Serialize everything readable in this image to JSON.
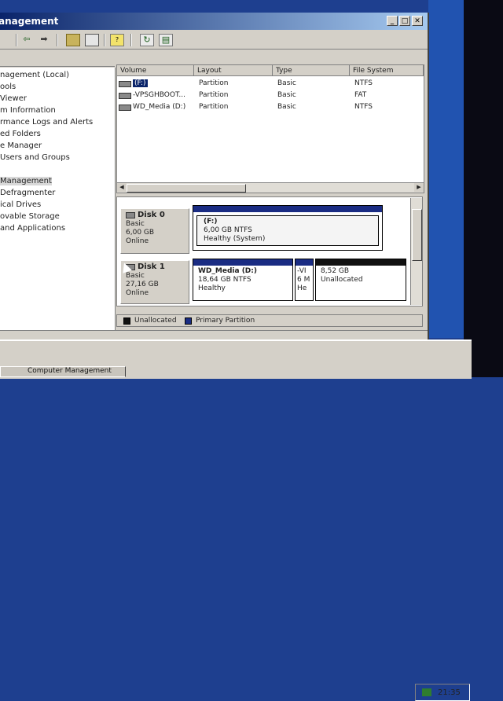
{
  "window": {
    "title": "anagement",
    "controls": [
      "_",
      "□",
      "✕"
    ]
  },
  "toolbar": {
    "icons": [
      "back-arrow-icon",
      "forward-arrow-icon",
      "up-folder-icon",
      "properties-icon",
      "help-icon",
      "refresh-icon",
      "export-icon"
    ]
  },
  "tree": {
    "items": [
      "nagement (Local)",
      "ools",
      " Viewer",
      "m Information",
      "rmance Logs and Alerts",
      "ed Folders",
      "e Manager",
      " Users and Groups",
      "",
      "Management",
      "Defragmenter",
      "ical Drives",
      "ovable Storage",
      " and Applications"
    ],
    "selected_index": 9
  },
  "volumes": {
    "columns": [
      "Volume",
      "Layout",
      "Type",
      "File System"
    ],
    "rows": [
      {
        "volume": "(F:)",
        "layout": "Partition",
        "type": "Basic",
        "fs": "NTFS"
      },
      {
        "volume": "-VPSGHBOOT...",
        "layout": "Partition",
        "type": "Basic",
        "fs": "FAT"
      },
      {
        "volume": "WD_Media (D:)",
        "layout": "Partition",
        "type": "Basic",
        "fs": "NTFS"
      }
    ]
  },
  "disks": [
    {
      "name": "Disk 0",
      "kind": "Basic",
      "size": "6,00 GB",
      "status": "Online",
      "partitions": [
        {
          "name": "(F:)",
          "size": "6,00 GB NTFS",
          "status": "Healthy (System)"
        }
      ]
    },
    {
      "name": "Disk 1",
      "kind": "Basic",
      "size": "27,16 GB",
      "status": "Online",
      "partitions": [
        {
          "name": "WD_Media  (D:)",
          "size": "18,64 GB NTFS",
          "status": "Healthy"
        },
        {
          "name": "-VI",
          "size": "6 M",
          "status": "He"
        },
        {
          "name": "",
          "size": "8,52 GB",
          "status": "Unallocated"
        }
      ]
    }
  ],
  "legend": {
    "unallocated": "Unallocated",
    "primary": "Primary Partition",
    "unallocated_color": "#111111",
    "primary_color": "#1a2c83"
  },
  "taskbar": {
    "button": "Computer Management",
    "clock": "21:35"
  }
}
